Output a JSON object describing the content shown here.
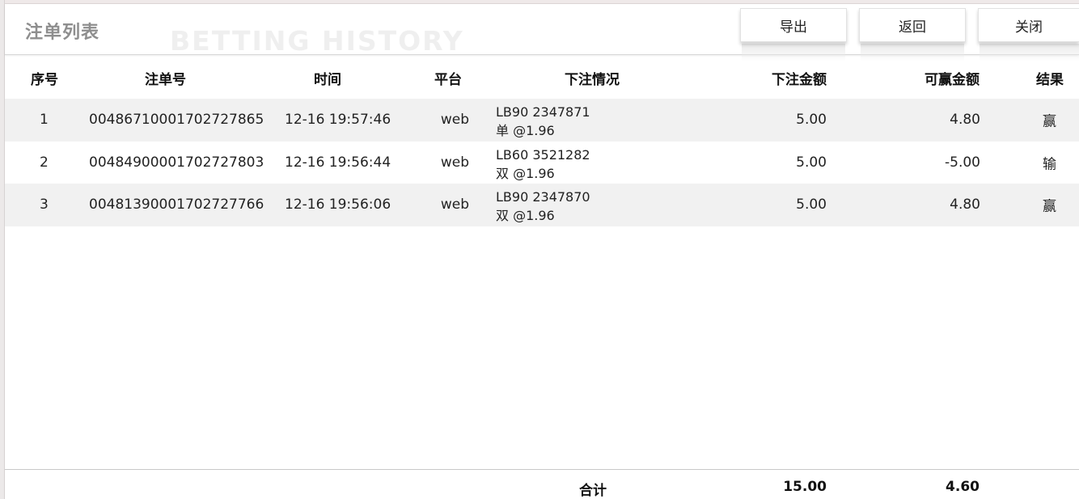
{
  "header": {
    "title": "注单列表",
    "watermark": "BETTING HISTORY",
    "buttons": {
      "export": "导出",
      "back": "返回",
      "close": "关闭"
    }
  },
  "table": {
    "columns": {
      "index": "序号",
      "ticket": "注单号",
      "time": "时间",
      "platform": "平台",
      "detail": "下注情况",
      "stake": "下注金额",
      "win": "可赢金额",
      "result": "结果"
    },
    "rows": [
      {
        "index": "1",
        "ticket": "00486710001702727865",
        "time": "12-16 19:57:46",
        "platform": "web",
        "detail_line1": "LB90 2347871",
        "detail_line2": "单 @1.96",
        "stake": "5.00",
        "win": "4.80",
        "result": "赢"
      },
      {
        "index": "2",
        "ticket": "00484900001702727803",
        "time": "12-16 19:56:44",
        "platform": "web",
        "detail_line1": "LB60 3521282",
        "detail_line2": "双 @1.96",
        "stake": "5.00",
        "win": "-5.00",
        "result": "输"
      },
      {
        "index": "3",
        "ticket": "00481390001702727766",
        "time": "12-16 19:56:06",
        "platform": "web",
        "detail_line1": "LB90 2347870",
        "detail_line2": "双 @1.96",
        "stake": "5.00",
        "win": "4.80",
        "result": "赢"
      }
    ],
    "footer": {
      "label": "合计",
      "stake_total": "15.00",
      "win_total": "4.60"
    }
  }
}
